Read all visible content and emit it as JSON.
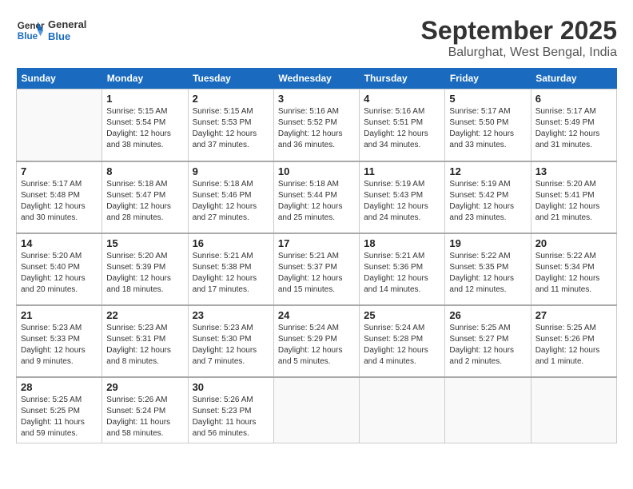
{
  "logo": {
    "text_general": "General",
    "text_blue": "Blue"
  },
  "title": "September 2025",
  "subtitle": "Balurghat, West Bengal, India",
  "days_of_week": [
    "Sunday",
    "Monday",
    "Tuesday",
    "Wednesday",
    "Thursday",
    "Friday",
    "Saturday"
  ],
  "weeks": [
    [
      {
        "day": "",
        "info": ""
      },
      {
        "day": "1",
        "info": "Sunrise: 5:15 AM\nSunset: 5:54 PM\nDaylight: 12 hours\nand 38 minutes."
      },
      {
        "day": "2",
        "info": "Sunrise: 5:15 AM\nSunset: 5:53 PM\nDaylight: 12 hours\nand 37 minutes."
      },
      {
        "day": "3",
        "info": "Sunrise: 5:16 AM\nSunset: 5:52 PM\nDaylight: 12 hours\nand 36 minutes."
      },
      {
        "day": "4",
        "info": "Sunrise: 5:16 AM\nSunset: 5:51 PM\nDaylight: 12 hours\nand 34 minutes."
      },
      {
        "day": "5",
        "info": "Sunrise: 5:17 AM\nSunset: 5:50 PM\nDaylight: 12 hours\nand 33 minutes."
      },
      {
        "day": "6",
        "info": "Sunrise: 5:17 AM\nSunset: 5:49 PM\nDaylight: 12 hours\nand 31 minutes."
      }
    ],
    [
      {
        "day": "7",
        "info": "Sunrise: 5:17 AM\nSunset: 5:48 PM\nDaylight: 12 hours\nand 30 minutes."
      },
      {
        "day": "8",
        "info": "Sunrise: 5:18 AM\nSunset: 5:47 PM\nDaylight: 12 hours\nand 28 minutes."
      },
      {
        "day": "9",
        "info": "Sunrise: 5:18 AM\nSunset: 5:46 PM\nDaylight: 12 hours\nand 27 minutes."
      },
      {
        "day": "10",
        "info": "Sunrise: 5:18 AM\nSunset: 5:44 PM\nDaylight: 12 hours\nand 25 minutes."
      },
      {
        "day": "11",
        "info": "Sunrise: 5:19 AM\nSunset: 5:43 PM\nDaylight: 12 hours\nand 24 minutes."
      },
      {
        "day": "12",
        "info": "Sunrise: 5:19 AM\nSunset: 5:42 PM\nDaylight: 12 hours\nand 23 minutes."
      },
      {
        "day": "13",
        "info": "Sunrise: 5:20 AM\nSunset: 5:41 PM\nDaylight: 12 hours\nand 21 minutes."
      }
    ],
    [
      {
        "day": "14",
        "info": "Sunrise: 5:20 AM\nSunset: 5:40 PM\nDaylight: 12 hours\nand 20 minutes."
      },
      {
        "day": "15",
        "info": "Sunrise: 5:20 AM\nSunset: 5:39 PM\nDaylight: 12 hours\nand 18 minutes."
      },
      {
        "day": "16",
        "info": "Sunrise: 5:21 AM\nSunset: 5:38 PM\nDaylight: 12 hours\nand 17 minutes."
      },
      {
        "day": "17",
        "info": "Sunrise: 5:21 AM\nSunset: 5:37 PM\nDaylight: 12 hours\nand 15 minutes."
      },
      {
        "day": "18",
        "info": "Sunrise: 5:21 AM\nSunset: 5:36 PM\nDaylight: 12 hours\nand 14 minutes."
      },
      {
        "day": "19",
        "info": "Sunrise: 5:22 AM\nSunset: 5:35 PM\nDaylight: 12 hours\nand 12 minutes."
      },
      {
        "day": "20",
        "info": "Sunrise: 5:22 AM\nSunset: 5:34 PM\nDaylight: 12 hours\nand 11 minutes."
      }
    ],
    [
      {
        "day": "21",
        "info": "Sunrise: 5:23 AM\nSunset: 5:33 PM\nDaylight: 12 hours\nand 9 minutes."
      },
      {
        "day": "22",
        "info": "Sunrise: 5:23 AM\nSunset: 5:31 PM\nDaylight: 12 hours\nand 8 minutes."
      },
      {
        "day": "23",
        "info": "Sunrise: 5:23 AM\nSunset: 5:30 PM\nDaylight: 12 hours\nand 7 minutes."
      },
      {
        "day": "24",
        "info": "Sunrise: 5:24 AM\nSunset: 5:29 PM\nDaylight: 12 hours\nand 5 minutes."
      },
      {
        "day": "25",
        "info": "Sunrise: 5:24 AM\nSunset: 5:28 PM\nDaylight: 12 hours\nand 4 minutes."
      },
      {
        "day": "26",
        "info": "Sunrise: 5:25 AM\nSunset: 5:27 PM\nDaylight: 12 hours\nand 2 minutes."
      },
      {
        "day": "27",
        "info": "Sunrise: 5:25 AM\nSunset: 5:26 PM\nDaylight: 12 hours\nand 1 minute."
      }
    ],
    [
      {
        "day": "28",
        "info": "Sunrise: 5:25 AM\nSunset: 5:25 PM\nDaylight: 11 hours\nand 59 minutes."
      },
      {
        "day": "29",
        "info": "Sunrise: 5:26 AM\nSunset: 5:24 PM\nDaylight: 11 hours\nand 58 minutes."
      },
      {
        "day": "30",
        "info": "Sunrise: 5:26 AM\nSunset: 5:23 PM\nDaylight: 11 hours\nand 56 minutes."
      },
      {
        "day": "",
        "info": ""
      },
      {
        "day": "",
        "info": ""
      },
      {
        "day": "",
        "info": ""
      },
      {
        "day": "",
        "info": ""
      }
    ]
  ]
}
